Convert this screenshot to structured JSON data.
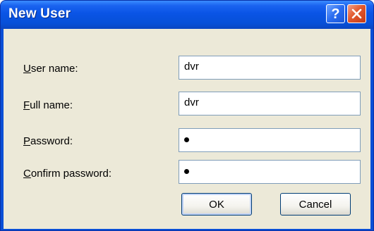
{
  "dialog": {
    "title": "New User",
    "help_icon": "question-mark-icon",
    "close_icon": "close-x-icon",
    "title_gradient": "#0a54e6",
    "close_color": "#e2582e"
  },
  "form": {
    "user_name": {
      "mnemonic": "U",
      "label_rest": "ser name:",
      "value": "dvr"
    },
    "full_name": {
      "mnemonic": "F",
      "label_rest": "ull name:",
      "value": "dvr"
    },
    "password": {
      "mnemonic": "P",
      "label_rest": "assword:",
      "masked_length": 1
    },
    "confirm_password": {
      "mnemonic": "C",
      "label_rest": "onfirm password:",
      "masked_length": 1
    }
  },
  "buttons": {
    "ok_label": "OK",
    "cancel_label": "Cancel"
  },
  "colors": {
    "dialog_face": "#ece9d8",
    "textbox_border": "#7f9db9"
  }
}
